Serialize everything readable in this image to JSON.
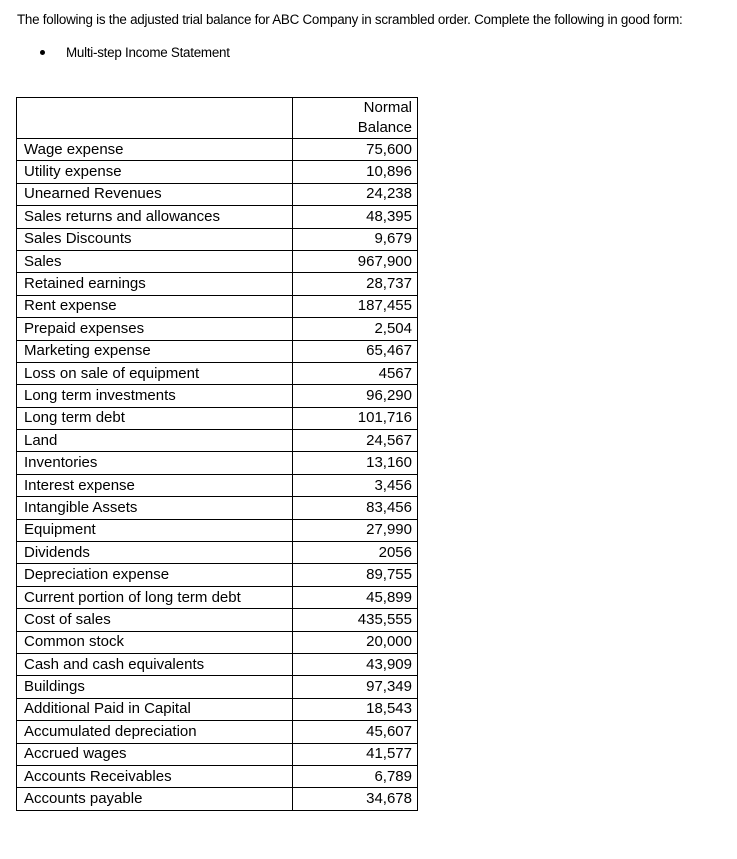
{
  "document": {
    "intro_text": "The following is the adjusted trial balance for ABC Company in scrambled order. Complete the following in good form:",
    "tasks": [
      "Multi-step Income Statement"
    ]
  },
  "table": {
    "headers": {
      "account": "",
      "balance_line1": "Normal",
      "balance_line2": "Balance"
    },
    "rows": [
      {
        "account": "Wage expense",
        "balance": "75,600"
      },
      {
        "account": "Utility expense",
        "balance": "10,896"
      },
      {
        "account": "Unearned Revenues",
        "balance": "24,238"
      },
      {
        "account": "Sales returns and allowances",
        "balance": "48,395"
      },
      {
        "account": "Sales Discounts",
        "balance": "9,679"
      },
      {
        "account": "Sales",
        "balance": "967,900"
      },
      {
        "account": "Retained earnings",
        "balance": "28,737"
      },
      {
        "account": "Rent expense",
        "balance": "187,455"
      },
      {
        "account": "Prepaid expenses",
        "balance": "2,504"
      },
      {
        "account": "Marketing expense",
        "balance": "65,467"
      },
      {
        "account": "Loss on sale of equipment",
        "balance": "4567"
      },
      {
        "account": "Long term investments",
        "balance": "96,290"
      },
      {
        "account": "Long term debt",
        "balance": "101,716"
      },
      {
        "account": "Land",
        "balance": "24,567"
      },
      {
        "account": "Inventories",
        "balance": "13,160"
      },
      {
        "account": "Interest expense",
        "balance": "3,456"
      },
      {
        "account": "Intangible Assets",
        "balance": "83,456"
      },
      {
        "account": "Equipment",
        "balance": "27,990"
      },
      {
        "account": "Dividends",
        "balance": "2056"
      },
      {
        "account": "Depreciation expense",
        "balance": "89,755"
      },
      {
        "account": "Current portion of long term debt",
        "balance": "45,899"
      },
      {
        "account": "Cost of sales",
        "balance": "435,555"
      },
      {
        "account": "Common stock",
        "balance": "20,000"
      },
      {
        "account": "Cash and cash equivalents",
        "balance": "43,909"
      },
      {
        "account": "Buildings",
        "balance": "97,349"
      },
      {
        "account": "Additional Paid in Capital",
        "balance": "18,543"
      },
      {
        "account": "Accumulated depreciation",
        "balance": "45,607"
      },
      {
        "account": "Accrued wages",
        "balance": "41,577"
      },
      {
        "account": "Accounts Receivables",
        "balance": "6,789"
      },
      {
        "account": "Accounts payable",
        "balance": "34,678"
      }
    ]
  }
}
